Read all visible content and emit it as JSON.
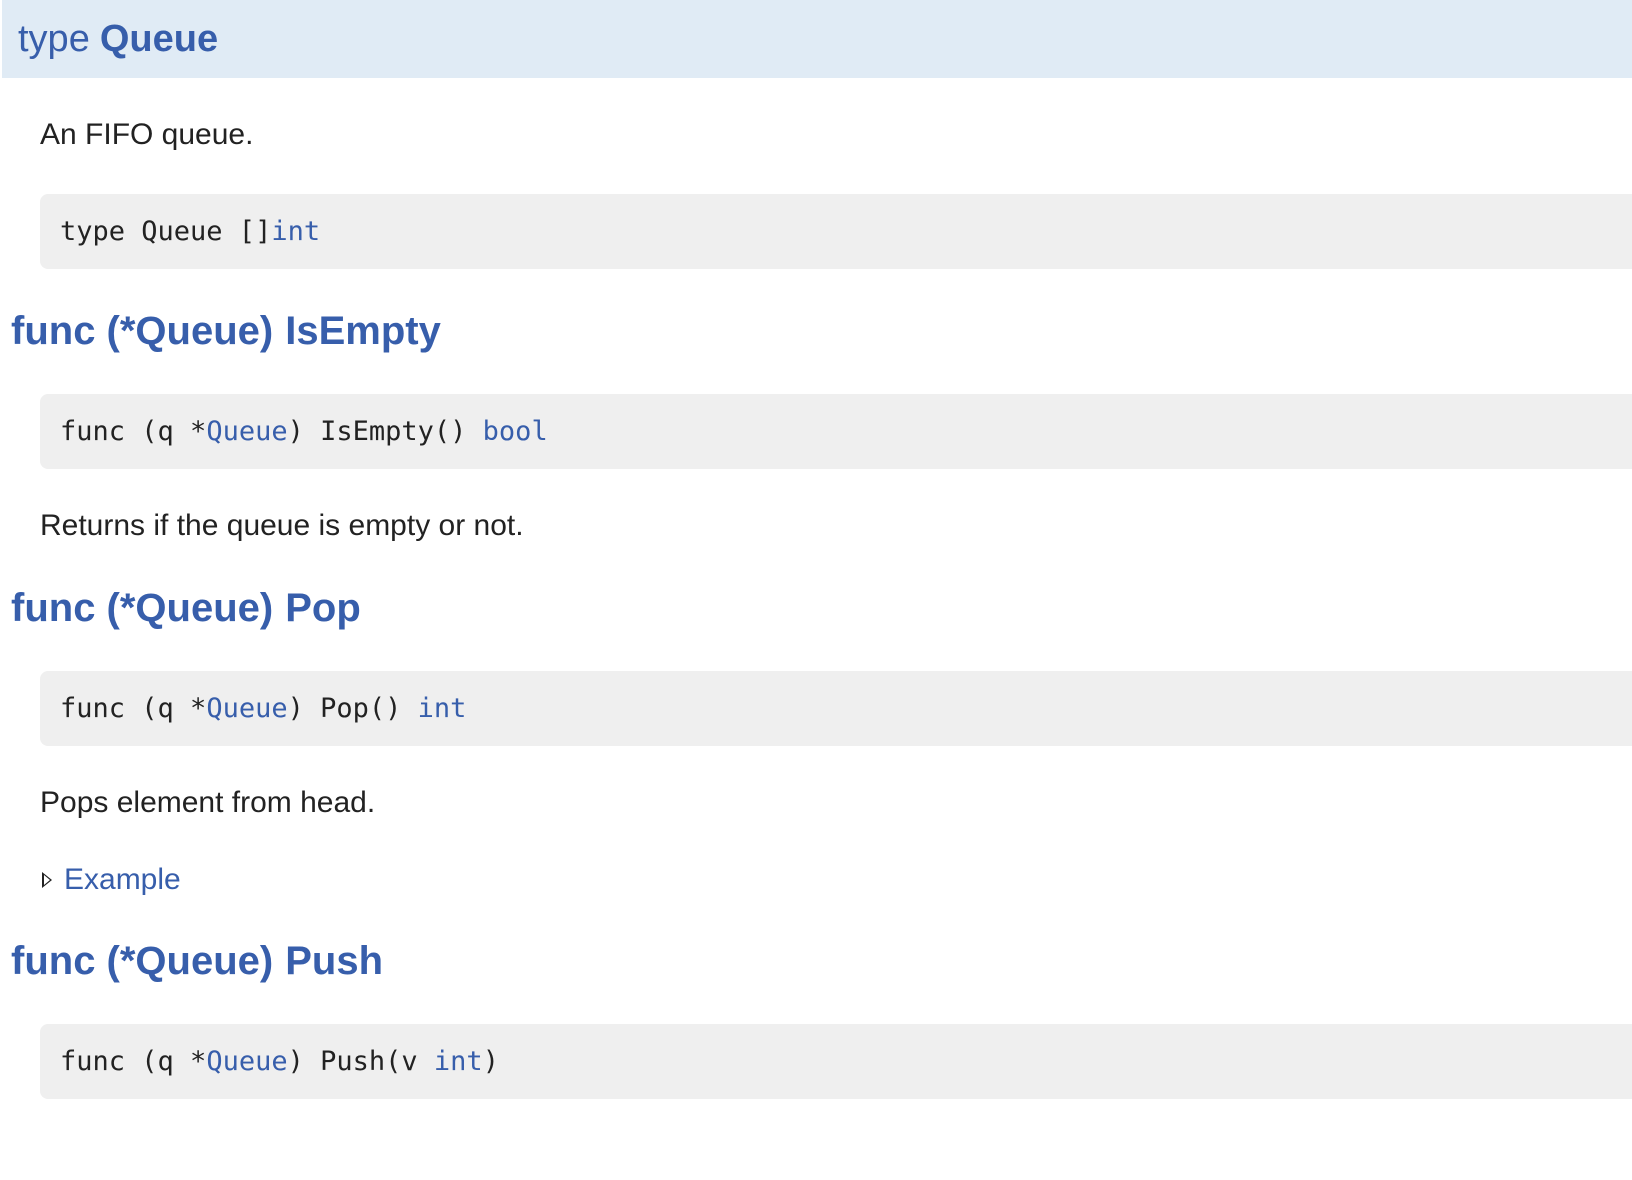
{
  "type_section": {
    "keyword": "type",
    "name": "Queue",
    "description": "An FIFO queue.",
    "decl": {
      "prefix": "type Queue []",
      "type_link": "int"
    }
  },
  "methods": [
    {
      "heading_receiver": "func (*Queue)",
      "heading_name": "IsEmpty",
      "sig": {
        "prefix": "func (q *",
        "recv_link": "Queue",
        "middle": ") IsEmpty() ",
        "ret_link": "bool",
        "suffix": ""
      },
      "description": "Returns if the queue is empty or not."
    },
    {
      "heading_receiver": "func (*Queue)",
      "heading_name": "Pop",
      "sig": {
        "prefix": "func (q *",
        "recv_link": "Queue",
        "middle": ") Pop() ",
        "ret_link": "int",
        "suffix": ""
      },
      "description": "Pops element from head.",
      "example_label": "Example"
    },
    {
      "heading_receiver": "func (*Queue)",
      "heading_name": "Push",
      "sig": {
        "prefix": "func (q *",
        "recv_link": "Queue",
        "middle": ") Push(v ",
        "ret_link": "int",
        "suffix": ")"
      }
    }
  ],
  "colors": {
    "link": "#375eab",
    "header_bg": "#e0ebf5",
    "code_bg": "#efefef",
    "text": "#222222"
  }
}
